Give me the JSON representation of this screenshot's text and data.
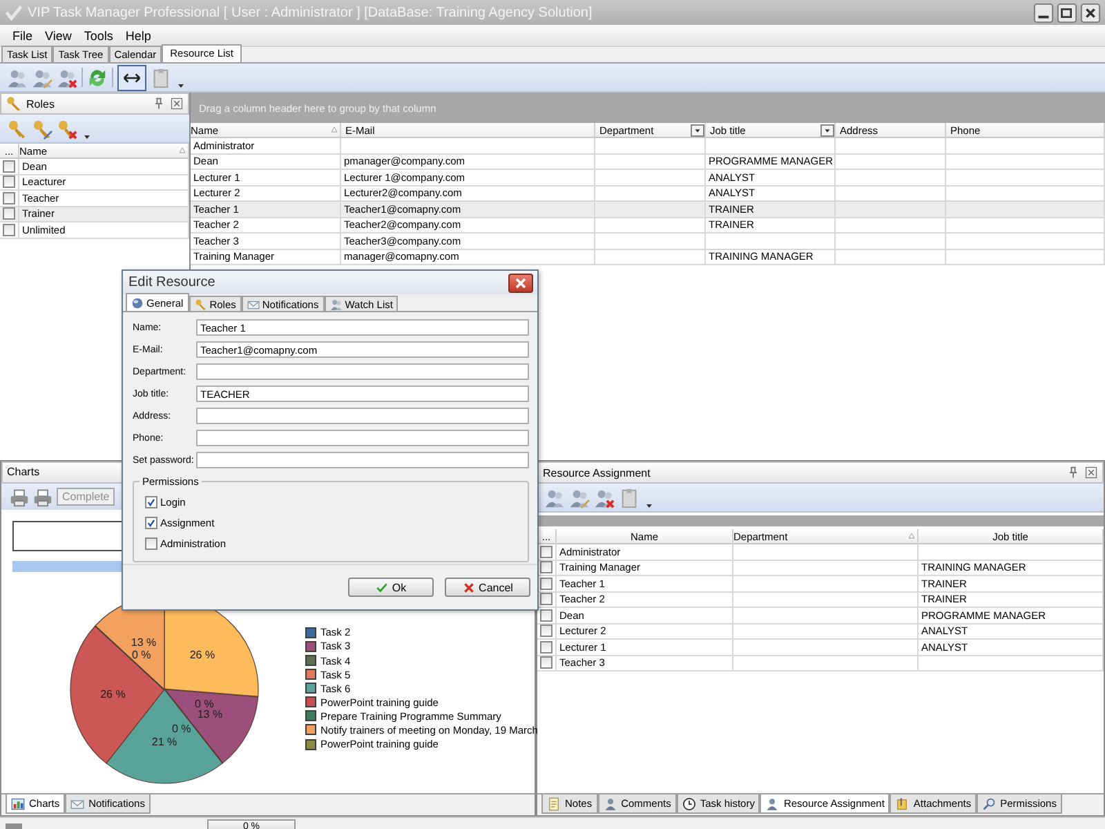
{
  "window": {
    "title": "VIP Task Manager Professional [ User : Administrator ] [DataBase: Training Agency Solution]"
  },
  "menu": [
    {
      "label": "File"
    },
    {
      "label": "View"
    },
    {
      "label": "Tools"
    },
    {
      "label": "Help"
    }
  ],
  "tabs": [
    {
      "label": "Task List",
      "selected": false
    },
    {
      "label": "Task Tree",
      "selected": false
    },
    {
      "label": "Calendar",
      "selected": false
    },
    {
      "label": "Resource List",
      "selected": true
    }
  ],
  "roles_pane": {
    "title": "Roles",
    "columns": [
      "...",
      "Name"
    ],
    "rows": [
      {
        "name": "Dean",
        "checked": false,
        "selected": false
      },
      {
        "name": "Leacturer",
        "checked": false,
        "selected": false
      },
      {
        "name": "Teacher",
        "checked": false,
        "selected": false
      },
      {
        "name": "Trainer",
        "checked": false,
        "selected": true
      },
      {
        "name": "Unlimited",
        "checked": false,
        "selected": false
      }
    ]
  },
  "resource_grid": {
    "group_hint": "Drag a column header here to group by that column",
    "columns": [
      "Name",
      "E-Mail",
      "Department",
      "Job title",
      "Address",
      "Phone"
    ],
    "rows": [
      {
        "name": "Administrator",
        "selected": false
      },
      {
        "name": "Dean",
        "email": "pmanager@company.com",
        "job_title": "PROGRAMME MANAGER",
        "selected": false
      },
      {
        "name": "Lecturer 1",
        "email": "Lecturer 1@company.com",
        "job_title": "ANALYST",
        "selected": false
      },
      {
        "name": "Lecturer 2",
        "email": "Lecturer2@company.com",
        "job_title": "ANALYST",
        "selected": false
      },
      {
        "name": "Teacher 1",
        "email": "Teacher1@comapny.com",
        "job_title": "TRAINER",
        "selected": true
      },
      {
        "name": "Teacher 2",
        "email": "Teacher2@company.com",
        "job_title": "TRAINER",
        "selected": false
      },
      {
        "name": "Teacher 3",
        "email": "Teacher3@company.com",
        "selected": false
      },
      {
        "name": "Training Manager",
        "email": "manager@comapny.com",
        "job_title": "TRAINING MANAGER",
        "selected": false
      }
    ]
  },
  "charts_pane": {
    "title": "Charts",
    "button": "Complete",
    "chart_data": {
      "type": "pie",
      "values": [
        26,
        0,
        13,
        0,
        21,
        26,
        0,
        13
      ],
      "colors": [
        "#fdbb5c",
        "#6e4a5e",
        "#9c4f7a",
        "#4a3a3a",
        "#5aa39a",
        "#cc5757",
        "#3a3a3a",
        "#f2a25e"
      ],
      "data_labels": true,
      "value_labels": [
        "26 %",
        "0 %",
        "13 %",
        "0 %",
        "21 %",
        "26 %",
        "0 %",
        "13 %"
      ]
    },
    "legend": [
      {
        "label": "Task 2",
        "color": "#3d6a9e"
      },
      {
        "label": "Task 3",
        "color": "#9c4f7a"
      },
      {
        "label": "Task 4",
        "color": "#5e6e55"
      },
      {
        "label": "Task 5",
        "color": "#e07a5f"
      },
      {
        "label": "Task 6",
        "color": "#5aa39a"
      },
      {
        "label": "PowerPoint training guide",
        "color": "#c84f4f"
      },
      {
        "label": "Prepare Training Programme Summary",
        "color": "#3d7a5e"
      },
      {
        "label": "Notify trainers of meeting on Monday, 19 March",
        "color": "#f0a060"
      },
      {
        "label": "PowerPoint training guide",
        "color": "#8a8a40"
      }
    ],
    "tabs": [
      {
        "label": "Charts",
        "selected": true
      },
      {
        "label": "Notifications",
        "selected": false
      }
    ]
  },
  "assignment_pane": {
    "title": "Resource Assignment",
    "columns": [
      "...",
      "Name",
      "Department",
      "Job title"
    ],
    "rows": [
      {
        "name": "Administrator",
        "checked": false
      },
      {
        "name": "Training Manager",
        "job_title": "TRAINING MANAGER",
        "checked": false
      },
      {
        "name": "Teacher 1",
        "job_title": "TRAINER",
        "checked": false
      },
      {
        "name": "Teacher 2",
        "job_title": "TRAINER",
        "checked": false
      },
      {
        "name": "Dean",
        "job_title": "PROGRAMME MANAGER",
        "checked": false
      },
      {
        "name": "Lecturer 2",
        "job_title": "ANALYST",
        "checked": false
      },
      {
        "name": "Lecturer 1",
        "job_title": "ANALYST",
        "checked": false
      },
      {
        "name": "Teacher 3",
        "checked": false
      }
    ],
    "tabs": [
      {
        "label": "Notes",
        "selected": false
      },
      {
        "label": "Comments",
        "selected": false
      },
      {
        "label": "Task history",
        "selected": false
      },
      {
        "label": "Resource Assignment",
        "selected": true
      },
      {
        "label": "Attachments",
        "selected": false
      },
      {
        "label": "Permissions",
        "selected": false
      }
    ]
  },
  "dialog": {
    "title": "Edit Resource",
    "tabs": [
      {
        "label": "General",
        "selected": true
      },
      {
        "label": "Roles",
        "selected": false
      },
      {
        "label": "Notifications",
        "selected": false
      },
      {
        "label": "Watch List",
        "selected": false
      }
    ],
    "fields": [
      {
        "label": "Name:",
        "value": "Teacher 1"
      },
      {
        "label": "E-Mail:",
        "value": "Teacher1@comapny.com"
      },
      {
        "label": "Department:"
      },
      {
        "label": "Job title:",
        "value": "TEACHER"
      },
      {
        "label": "Address:"
      },
      {
        "label": "Phone:"
      },
      {
        "label": "Set password:"
      }
    ],
    "permissions": {
      "title": "Permissions",
      "items": [
        {
          "label": "Login",
          "checked": true
        },
        {
          "label": "Assignment",
          "checked": true
        },
        {
          "label": "Administration",
          "checked": false
        }
      ]
    },
    "buttons": [
      {
        "label": "Ok",
        "kind": "ok"
      },
      {
        "label": "Cancel",
        "kind": "cancel"
      }
    ]
  },
  "status_bar": {
    "progress": "0 %",
    "level": 0
  }
}
